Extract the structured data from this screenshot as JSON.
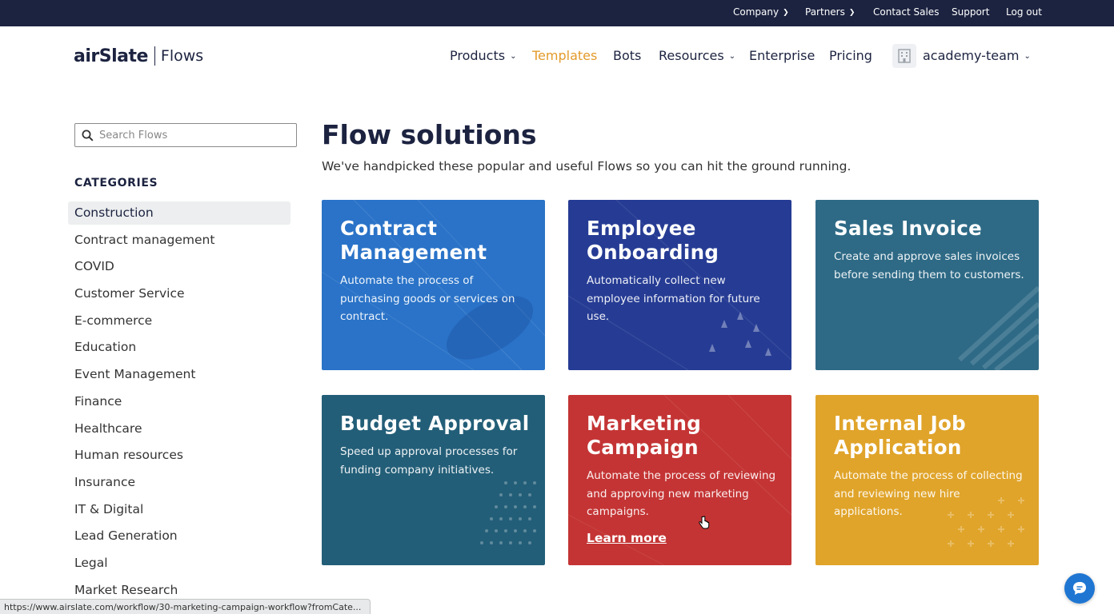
{
  "topbar": {
    "company": "Company",
    "partners": "Partners",
    "contact_sales": "Contact Sales",
    "support": "Support",
    "logout": "Log out"
  },
  "header": {
    "logo_main": "airSlate",
    "logo_sub": "Flows",
    "nav": {
      "products": "Products",
      "templates": "Templates",
      "bots": "Bots",
      "resources": "Resources",
      "enterprise": "Enterprise",
      "pricing": "Pricing"
    },
    "team": "academy-team"
  },
  "sidebar": {
    "search_placeholder": "Search Flows",
    "categories_heading": "CATEGORIES",
    "categories": [
      "Construction",
      "Contract management",
      "COVID",
      "Customer Service",
      "E-commerce",
      "Education",
      "Event Management",
      "Finance",
      "Healthcare",
      "Human resources",
      "Insurance",
      "IT & Digital",
      "Lead Generation",
      "Legal",
      "Market Research"
    ]
  },
  "main": {
    "title": "Flow solutions",
    "subtitle": "We've handpicked these popular and useful Flows so you can hit the ground running.",
    "cards": [
      {
        "title_line1": "Contract",
        "title_line2": "Management",
        "desc": "Automate the process of purchasing goods or services on contract.",
        "color": "#2a73c8"
      },
      {
        "title_line1": "Employee",
        "title_line2": "Onboarding",
        "desc": "Automatically collect new employee information for future use.",
        "color": "#263c94"
      },
      {
        "title_line1": "Sales Invoice",
        "desc": "Create and approve sales invoices before sending them to customers.",
        "color": "#2e6a86"
      },
      {
        "title_line1": "Budget Approval",
        "desc": "Speed up approval processes for funding company initiatives.",
        "color": "#235e78"
      },
      {
        "title_line1": "Marketing",
        "title_line2": "Campaign",
        "desc": "Automate the process of reviewing and approving new marketing campaigns.",
        "learn_more": "Learn more",
        "color": "#c43434"
      },
      {
        "title_line1": "Internal Job",
        "title_line2": "Application",
        "desc": "Automate the process of collecting and reviewing new hire applications.",
        "color": "#e0a42a"
      }
    ]
  },
  "statusbar": {
    "url": "https://www.airslate.com/workflow/30-marketing-campaign-workflow?fromCate..."
  },
  "colors": {
    "dark_navy": "#1c2340",
    "accent_orange": "#e39a2a",
    "chat_blue": "#1f76d2"
  }
}
